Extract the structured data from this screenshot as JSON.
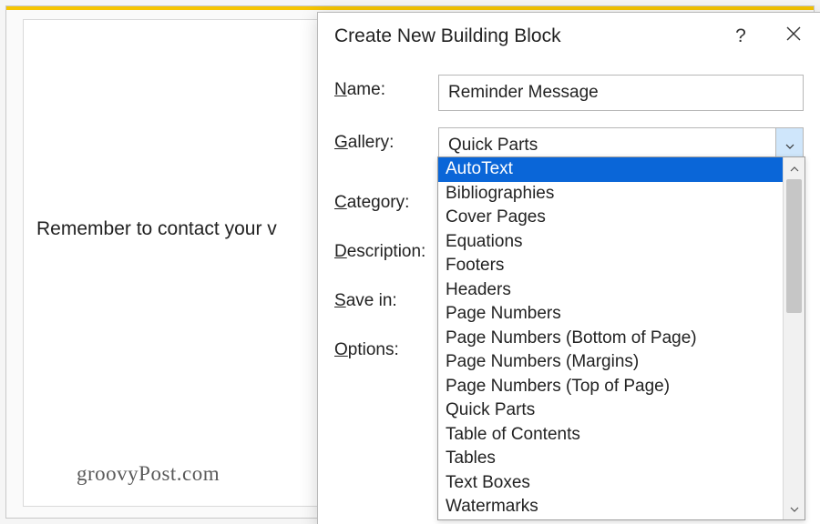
{
  "document": {
    "body_text": "Remember to contact your v",
    "watermark": "groovyPost.com"
  },
  "dialog": {
    "title": "Create New Building Block",
    "help_symbol": "?",
    "labels": {
      "name": {
        "pre": "N",
        "post": "ame:"
      },
      "gallery": {
        "pre": "G",
        "post": "allery:"
      },
      "category": {
        "pre": "C",
        "post": "ategory:"
      },
      "description": {
        "pre": "D",
        "post": "escription:"
      },
      "save_in": {
        "pre": "S",
        "post": "ave in:"
      },
      "options": {
        "pre": "O",
        "post": "ptions:"
      }
    },
    "fields": {
      "name_value": "Reminder Message",
      "gallery_value": "Quick Parts"
    },
    "gallery_options": [
      "AutoText",
      "Bibliographies",
      "Cover Pages",
      "Equations",
      "Footers",
      "Headers",
      "Page Numbers",
      "Page Numbers (Bottom of Page)",
      "Page Numbers (Margins)",
      "Page Numbers (Top of Page)",
      "Quick Parts",
      "Table of Contents",
      "Tables",
      "Text Boxes",
      "Watermarks"
    ],
    "gallery_selected_index": 0
  }
}
